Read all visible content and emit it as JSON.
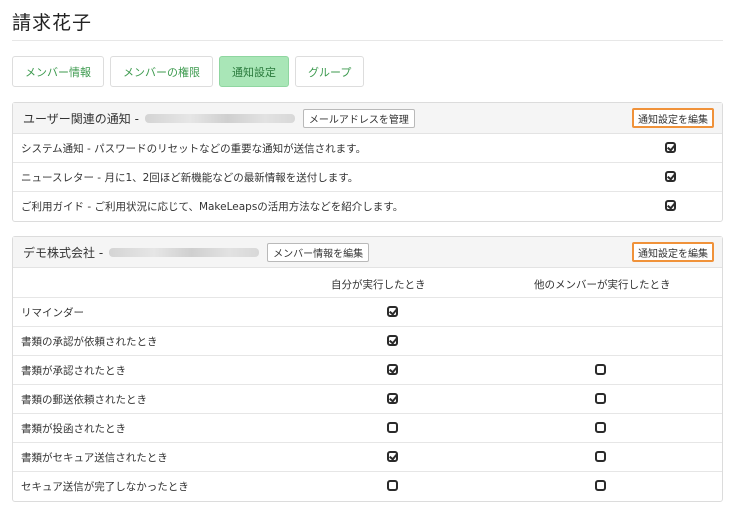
{
  "page": {
    "title": "請求花子"
  },
  "tabs": [
    {
      "label": "メンバー情報",
      "active": false
    },
    {
      "label": "メンバーの権限",
      "active": false
    },
    {
      "label": "通知設定",
      "active": true
    },
    {
      "label": "グループ",
      "active": false
    }
  ],
  "user_notifications": {
    "title": "ユーザー関連の通知 -",
    "manage_email_label": "メールアドレスを管理",
    "edit_label": "通知設定を編集",
    "rows": [
      {
        "label": "システム通知 - パスワードのリセットなどの重要な通知が送信されます。",
        "checked": true
      },
      {
        "label": "ニュースレター - 月に1、2回ほど新機能などの最新情報を送付します。",
        "checked": true
      },
      {
        "label": "ご利用ガイド - ご利用状況に応じて、MakeLeapsの活用方法などを紹介します。",
        "checked": true
      }
    ]
  },
  "company_notifications": {
    "title": "デモ株式会社 -",
    "edit_member_label": "メンバー情報を編集",
    "edit_label": "通知設定を編集",
    "columns": {
      "self": "自分が実行したとき",
      "others": "他のメンバーが実行したとき"
    },
    "rows": [
      {
        "label": "リマインダー",
        "self": true,
        "others": null
      },
      {
        "label": "書類の承認が依頼されたとき",
        "self": true,
        "others": null
      },
      {
        "label": "書類が承認されたとき",
        "self": true,
        "others": false
      },
      {
        "label": "書類の郵送依頼されたとき",
        "self": true,
        "others": false
      },
      {
        "label": "書類が投函されたとき",
        "self": false,
        "others": false
      },
      {
        "label": "書類がセキュア送信されたとき",
        "self": true,
        "others": false
      },
      {
        "label": "セキュア送信が完了しなかったとき",
        "self": false,
        "others": false
      }
    ]
  },
  "colors": {
    "accent_green": "#a9e6b7",
    "tab_text_green": "#3c9a4e",
    "highlight_orange": "#f0923a"
  }
}
